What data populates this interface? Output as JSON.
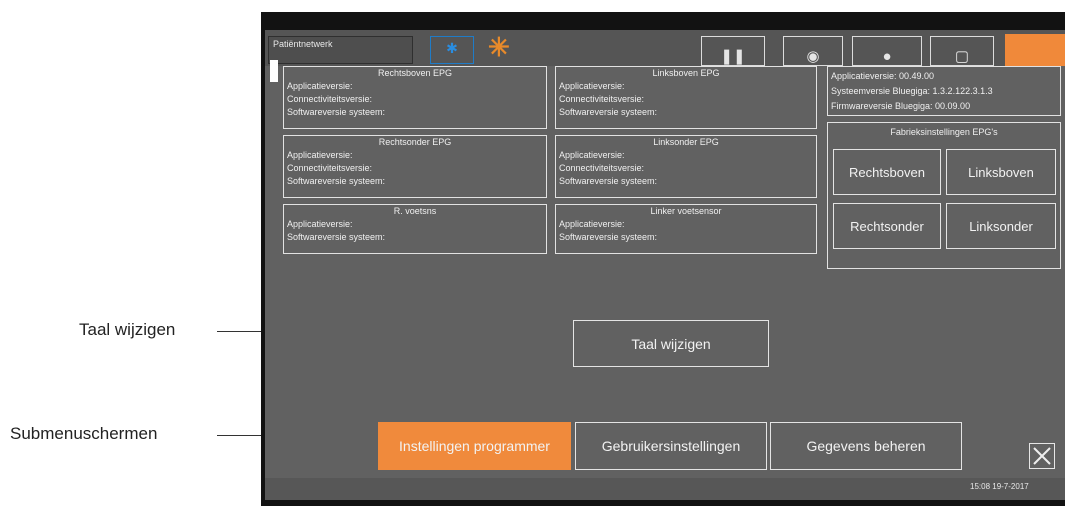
{
  "callouts": {
    "taal": "Taal wijzigen",
    "submenu": "Submenuschermen"
  },
  "topbar": {
    "network_label": "Patiëntnetwerk",
    "bluetooth_icon": "bluetooth-icon"
  },
  "epg_panels": {
    "rechtsboven": {
      "title": "Rechtsboven EPG",
      "lines": [
        "Applicatieversie:",
        "Connectiviteitsversie:",
        "Softwareversie systeem:"
      ]
    },
    "linksboven": {
      "title": "Linksboven EPG",
      "lines": [
        "Applicatieversie:",
        "Connectiviteitsversie:",
        "Softwareversie systeem:"
      ]
    },
    "rechtsonder": {
      "title": "Rechtsonder EPG",
      "lines": [
        "Applicatieversie:",
        "Connectiviteitsversie:",
        "Softwareversie systeem:"
      ]
    },
    "linksonder": {
      "title": "Linksonder EPG",
      "lines": [
        "Applicatieversie:",
        "Connectiviteitsversie:",
        "Softwareversie systeem:"
      ]
    },
    "r_voet": {
      "title": "R. voetsns",
      "lines": [
        "Applicatieversie:",
        "Softwareversie systeem:"
      ]
    },
    "l_voet": {
      "title": "Linker voetsensor",
      "lines": [
        "Applicatieversie:",
        "Softwareversie systeem:"
      ]
    }
  },
  "system_info": {
    "lines": [
      "Applicatieversie: 00.49.00",
      "Systeemversie Bluegiga:  1.3.2.122.3.1.3",
      "Firmwareversie Bluegiga:  00.09.00"
    ]
  },
  "factory": {
    "title": "Fabrieksinstellingen EPG's",
    "buttons": [
      "Rechtsboven",
      "Linksboven",
      "Rechtsonder",
      "Linksonder"
    ]
  },
  "language_button": "Taal wijzigen",
  "submenu_tabs": [
    "Instellingen programmer",
    "Gebruikersinstellingen",
    "Gegevens beheren"
  ],
  "status_time": "15:08 19-7-2017",
  "colors": {
    "accent": "#f08a3c",
    "screen_bg": "#616161"
  }
}
